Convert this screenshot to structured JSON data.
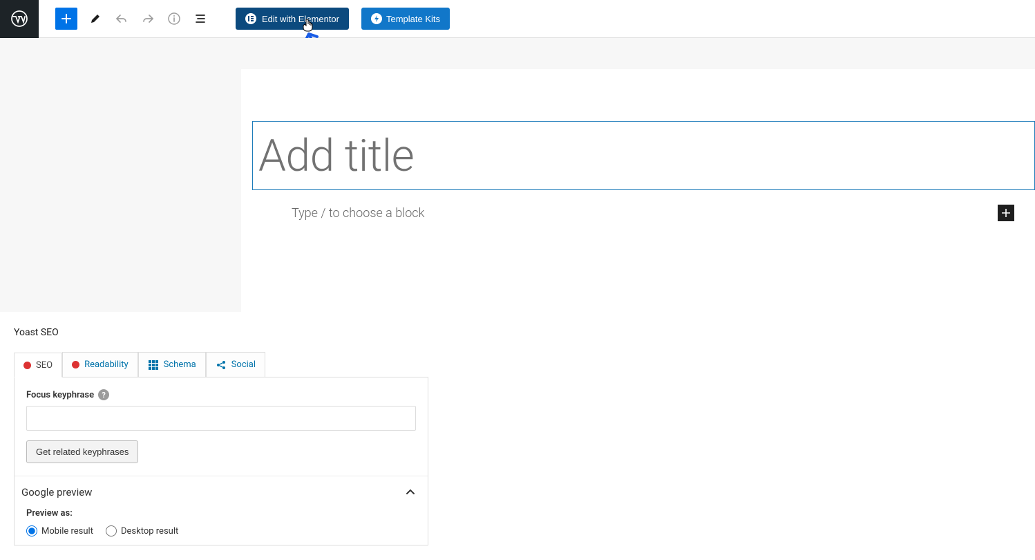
{
  "toolbar": {
    "elementor_label": "Edit with Elementor",
    "template_label": "Template Kits"
  },
  "editor": {
    "title_placeholder": "Add title",
    "block_prompt": "Type / to choose a block"
  },
  "meta": {
    "title": "Yoast SEO",
    "tabs": {
      "seo": "SEO",
      "readability": "Readability",
      "schema": "Schema",
      "social": "Social"
    },
    "focus_label": "Focus keyphrase",
    "focus_value": "",
    "related_btn": "Get related keyphrases",
    "google_preview": "Google preview",
    "preview_as": "Preview as:",
    "radio_mobile": "Mobile result",
    "radio_desktop": "Desktop result"
  }
}
